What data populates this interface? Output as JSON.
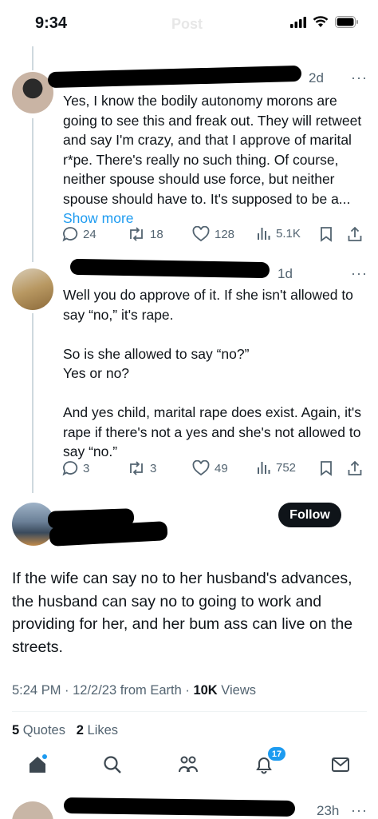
{
  "status_bar": {
    "time": "9:34",
    "ghost_title": "Post"
  },
  "reply1": {
    "time": "2d",
    "text": "Yes, I know the bodily autonomy morons are going to see this and freak out. They will retweet and say I'm crazy, and that I approve of marital r*pe. There's really no such thing. Of course, neither spouse should use force, but neither spouse should have to. It's supposed to be a...",
    "show_more": "Show more",
    "replies": "24",
    "reposts": "18",
    "likes": "128",
    "views": "5.1K"
  },
  "reply2": {
    "time": "1d",
    "text": "Well you do approve of it. If she isn't allowed to say “no,” it's rape.\n\nSo is she allowed to say “no?”\nYes or no?\n\nAnd yes child, marital rape does exist. Again, it's rape if there's not a yes and she's not allowed to say “no.”",
    "replies": "3",
    "reposts": "3",
    "likes": "49",
    "views": "752"
  },
  "main_post": {
    "follow_label": "Follow",
    "text": "If the wife can say no to her husband's advances, the husband can say no to going to work and providing for her, and her bum ass can live on the streets.",
    "time_date": "5:24 PM · 12/2/23 from Earth · ",
    "views_count": "10K",
    "views_label": " Views",
    "quotes_count": "5",
    "quotes_label": " Quotes",
    "likes_count": "2",
    "likes_label": " Likes"
  },
  "tab_bar": {
    "notification_badge": "17"
  },
  "bottom_peek": {
    "time": "23h"
  },
  "colors": {
    "accent": "#1d9bf0",
    "text": "#0f1419",
    "muted": "#536471"
  },
  "icons": [
    "signal-icon",
    "wifi-icon",
    "battery-icon",
    "reply-icon",
    "repost-icon",
    "like-icon",
    "views-icon",
    "bookmark-icon",
    "share-icon",
    "home-icon",
    "search-icon",
    "communities-icon",
    "notifications-icon",
    "messages-icon",
    "more-icon"
  ]
}
